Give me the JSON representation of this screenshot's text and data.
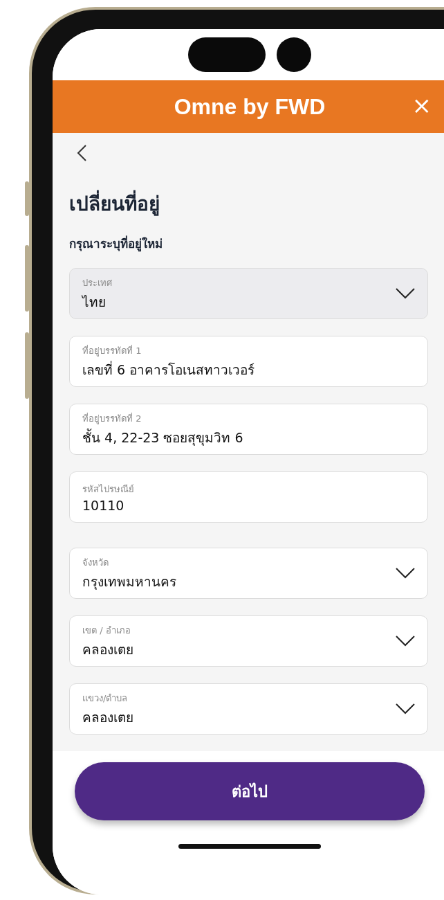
{
  "header": {
    "title": "Omne by FWD",
    "close": "×"
  },
  "page": {
    "title": "เปลี่ยนที่อยู่",
    "subtitle": "กรุณาระบุที่อยู่ใหม่"
  },
  "fields": [
    {
      "kind": "select",
      "label": "ประเทศ",
      "value": "ไทย",
      "disabled": true
    },
    {
      "kind": "text",
      "label": "ที่อยู่บรรทัดที่ 1",
      "value": "เลขที่ 6 อาคารโอเนสทาวเวอร์",
      "disabled": false
    },
    {
      "kind": "text",
      "label": "ที่อยู่บรรทัดที่ 2",
      "value": "ชั้น 4, 22-23 ซอยสุขุมวิท 6",
      "disabled": false
    },
    {
      "kind": "text",
      "label": "รหัสไปรษณีย์",
      "value": "10110",
      "disabled": false
    },
    {
      "kind": "select",
      "label": "จังหวัด",
      "value": "กรุงเทพมหานคร",
      "disabled": false
    },
    {
      "kind": "select",
      "label": "เขต / อำเภอ",
      "value": "คลองเตย",
      "disabled": false
    },
    {
      "kind": "select",
      "label": "แขวง/ตำบล",
      "value": "คลองเตย",
      "disabled": false
    }
  ],
  "next_button": "ต่อไป"
}
